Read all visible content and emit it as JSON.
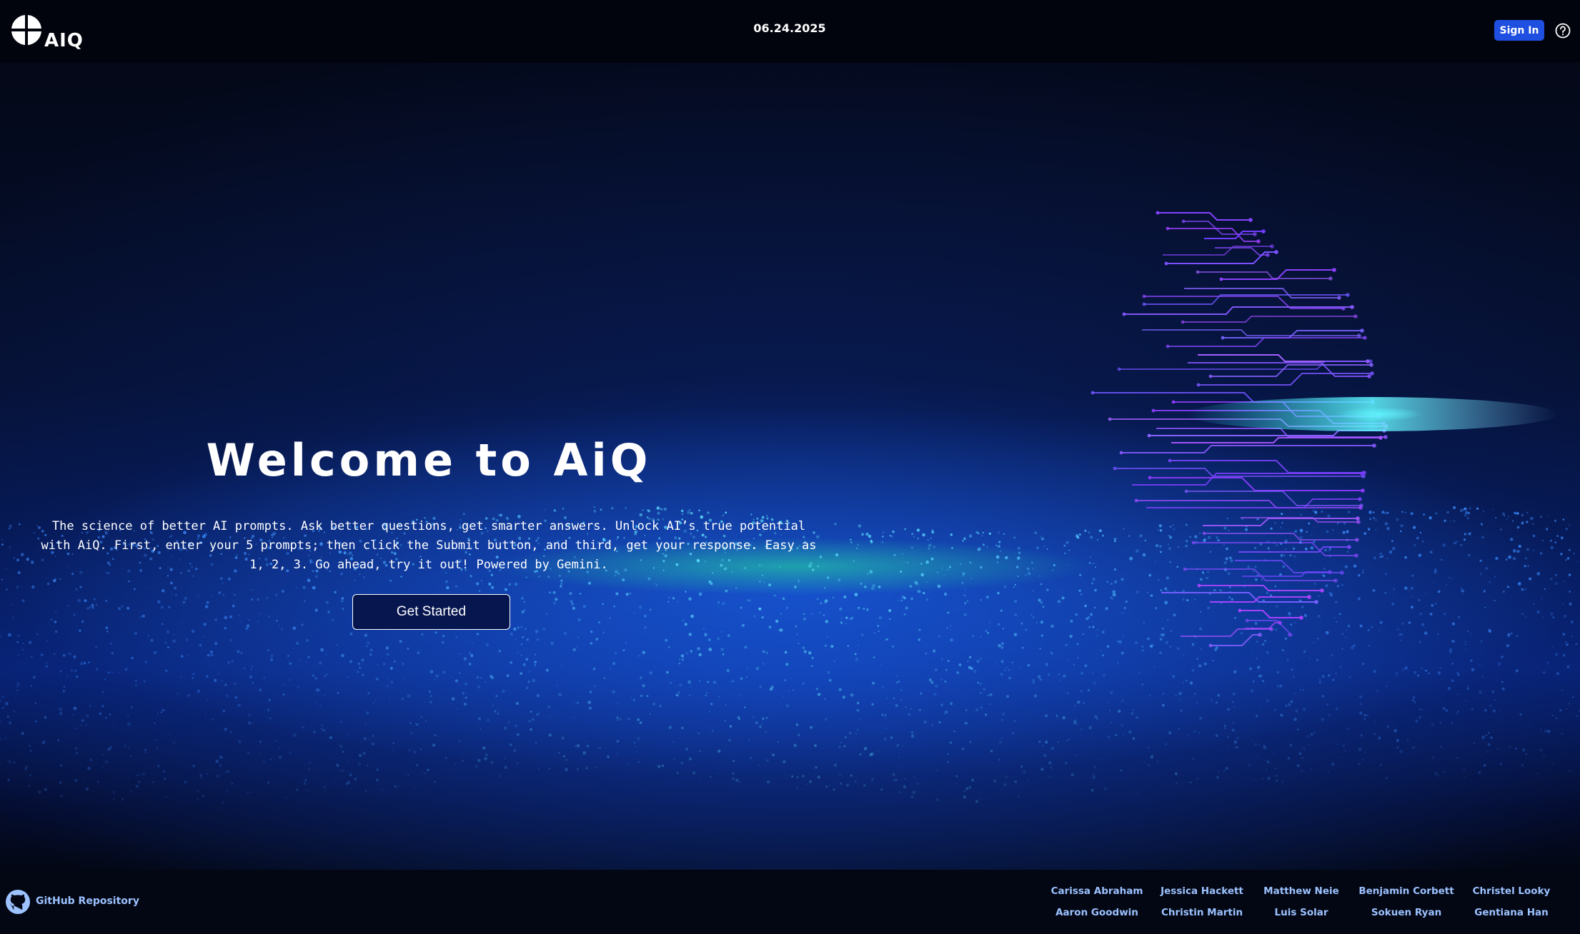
{
  "header": {
    "logo_text": "AIQ",
    "date": "06.24.2025",
    "signin_label": "Sign In"
  },
  "hero": {
    "title": "Welcome to AiQ",
    "description": "The science of better AI prompts. Ask better questions, get smarter answers. Unlock AI’s true potential with AiQ. First, enter your 5 prompts; then click the Submit button, and third, get your response. Easy as 1, 2, 3. Go ahead, try it out! Powered by Gemini.",
    "cta_label": "Get Started"
  },
  "footer": {
    "github_label": "GitHub Repository",
    "team": [
      "Carissa Abraham",
      "Jessica Hackett",
      "Matthew Neie",
      "Benjamin Corbett",
      "Christel Looky",
      "Aaron Goodwin",
      "Christin Martin",
      "Luis Solar",
      "Sokuen Ryan",
      "Gentiana Han"
    ]
  },
  "colors": {
    "accent": "#1e4fe0",
    "link": "#9cc2ff",
    "background": "#030714",
    "circuit": "#7a3cff"
  },
  "icons": [
    "aiq-logo-icon",
    "help-icon",
    "github-icon",
    "circuit-head-illustration"
  ]
}
